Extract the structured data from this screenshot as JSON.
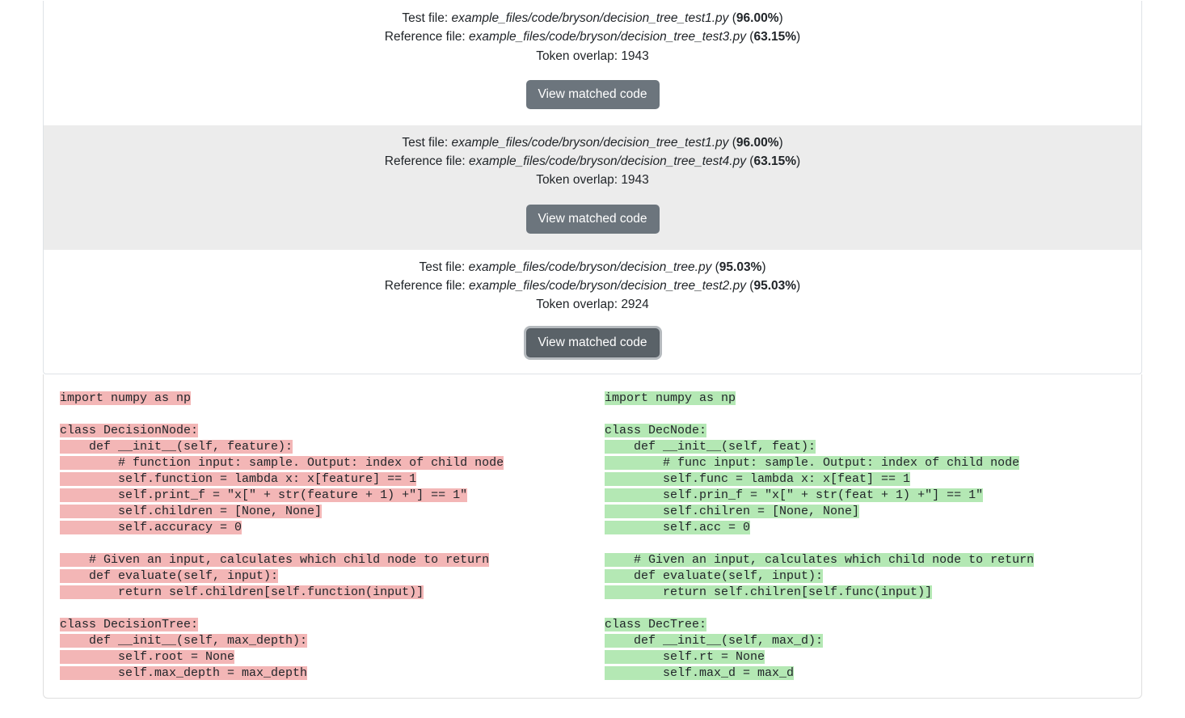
{
  "matches": [
    {
      "test_label": "Test file: ",
      "test_file": "example_files/code/bryson/decision_tree_test1.py",
      "test_pct": "96.00%",
      "ref_label": "Reference file: ",
      "ref_file": "example_files/code/bryson/decision_tree_test3.py",
      "ref_pct": "63.15%",
      "overlap_label": "Token overlap: ",
      "overlap_value": "1943",
      "button_label": "View matched code",
      "striped": false,
      "expanded": false
    },
    {
      "test_label": "Test file: ",
      "test_file": "example_files/code/bryson/decision_tree_test1.py",
      "test_pct": "96.00%",
      "ref_label": "Reference file: ",
      "ref_file": "example_files/code/bryson/decision_tree_test4.py",
      "ref_pct": "63.15%",
      "overlap_label": "Token overlap: ",
      "overlap_value": "1943",
      "button_label": "View matched code",
      "striped": true,
      "expanded": false
    },
    {
      "test_label": "Test file: ",
      "test_file": "example_files/code/bryson/decision_tree.py",
      "test_pct": "95.03%",
      "ref_label": "Reference file: ",
      "ref_file": "example_files/code/bryson/decision_tree_test2.py",
      "ref_pct": "95.03%",
      "overlap_label": "Token overlap: ",
      "overlap_value": "2924",
      "button_label": "View matched code",
      "striped": false,
      "expanded": true
    }
  ],
  "code_left": [
    {
      "hl": true,
      "text": "import numpy as np"
    },
    {
      "hl": false,
      "text": ""
    },
    {
      "hl": true,
      "text": "class DecisionNode:"
    },
    {
      "hl": true,
      "text": "    def __init__(self, feature):"
    },
    {
      "hl": true,
      "text": "        # function input: sample. Output: index of child node"
    },
    {
      "hl": true,
      "text": "        self.function = lambda x: x[feature] == 1"
    },
    {
      "hl": true,
      "text": "        self.print_f = \"x[\" + str(feature + 1) +\"] == 1\""
    },
    {
      "hl": true,
      "text": "        self.children = [None, None]"
    },
    {
      "hl": true,
      "text": "        self.accuracy = 0"
    },
    {
      "hl": false,
      "text": ""
    },
    {
      "hl": true,
      "text": "    # Given an input, calculates which child node to return"
    },
    {
      "hl": true,
      "text": "    def evaluate(self, input):"
    },
    {
      "hl": true,
      "text": "        return self.children[self.function(input)]"
    },
    {
      "hl": false,
      "text": ""
    },
    {
      "hl": true,
      "text": "class DecisionTree:"
    },
    {
      "hl": true,
      "text": "    def __init__(self, max_depth):"
    },
    {
      "hl": true,
      "text": "        self.root = None"
    },
    {
      "hl": true,
      "text": "        self.max_depth = max_depth"
    }
  ],
  "code_right": [
    {
      "hl": true,
      "text": "import numpy as np"
    },
    {
      "hl": false,
      "text": ""
    },
    {
      "hl": true,
      "text": "class DecNode:"
    },
    {
      "hl": true,
      "text": "    def __init__(self, feat):"
    },
    {
      "hl": true,
      "text": "        # func input: sample. Output: index of child node"
    },
    {
      "hl": true,
      "text": "        self.func = lambda x: x[feat] == 1"
    },
    {
      "hl": true,
      "text": "        self.prin_f = \"x[\" + str(feat + 1) +\"] == 1\""
    },
    {
      "hl": true,
      "text": "        self.chilren = [None, None]"
    },
    {
      "hl": true,
      "text": "        self.acc = 0"
    },
    {
      "hl": false,
      "text": ""
    },
    {
      "hl": true,
      "text": "    # Given an input, calculates which child node to return"
    },
    {
      "hl": true,
      "text": "    def evaluate(self, input):"
    },
    {
      "hl": true,
      "text": "        return self.chilren[self.func(input)]"
    },
    {
      "hl": false,
      "text": ""
    },
    {
      "hl": true,
      "text": "class DecTree:"
    },
    {
      "hl": true,
      "text": "    def __init__(self, max_d):"
    },
    {
      "hl": true,
      "text": "        self.rt = None"
    },
    {
      "hl": true,
      "text": "        self.max_d = max_d"
    }
  ]
}
